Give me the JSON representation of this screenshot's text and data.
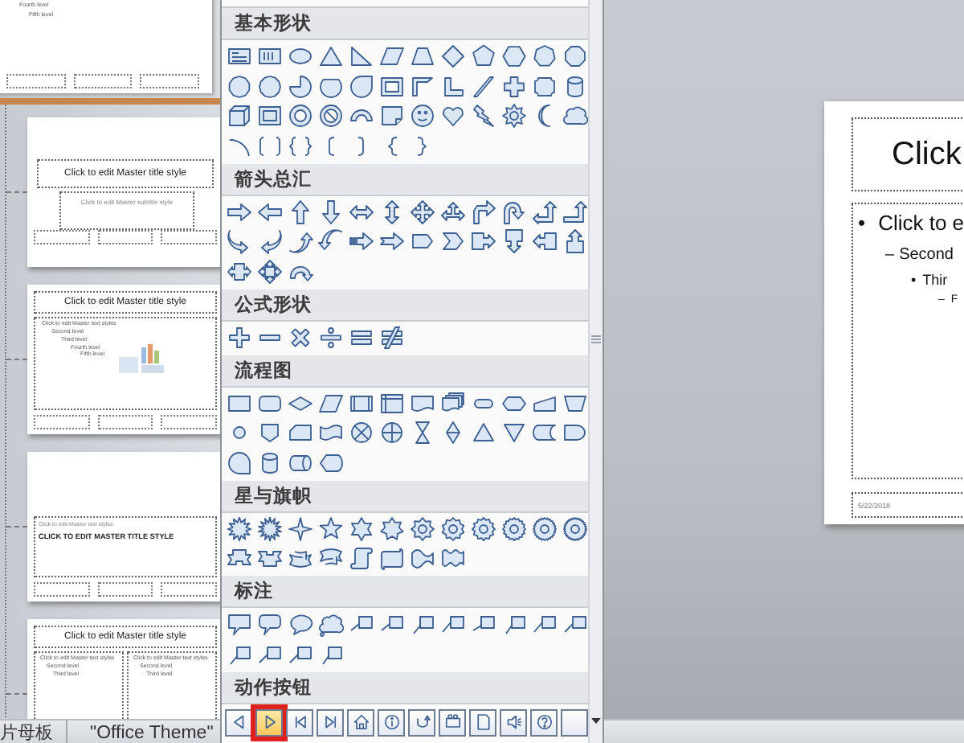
{
  "thumbnail_pane": {
    "partial_top": {
      "levels": [
        "Fourth level",
        "Fifth level"
      ]
    },
    "thumbnails": [
      {
        "kind": "title",
        "title": "Click to edit Master title style",
        "subtitle": "Click to edit Master subtitle style"
      },
      {
        "kind": "content",
        "title": "Click to edit Master title style",
        "levels": [
          "Click to edit Master text styles",
          "Second level",
          "Third level",
          "Fourth level",
          "Fifth level"
        ]
      },
      {
        "kind": "section",
        "text": "Click to edit Master text styles",
        "title": "CLICK TO EDIT MASTER TITLE STYLE"
      },
      {
        "kind": "two_content",
        "title": "Click to edit Master title style",
        "columns": [
          [
            "Click to edit Master text styles",
            "Second level",
            "Third level"
          ],
          [
            "Click to edit Master text styles",
            "Second level",
            "Third level"
          ]
        ]
      }
    ]
  },
  "shape_gallery": {
    "sections": [
      {
        "title": "基本形状"
      },
      {
        "title": "箭头总汇"
      },
      {
        "title": "公式形状"
      },
      {
        "title": "流程图"
      },
      {
        "title": "星与旗帜"
      },
      {
        "title": "标注"
      },
      {
        "title": "动作按钮",
        "shapes": [
          {
            "selected": false
          },
          {
            "selected": true
          },
          {
            "selected": false
          },
          {
            "selected": false
          },
          {
            "selected": false
          },
          {
            "selected": false
          },
          {
            "selected": false
          },
          {
            "selected": false
          },
          {
            "selected": false
          },
          {
            "selected": false
          },
          {
            "selected": false
          },
          {
            "selected": false
          }
        ]
      }
    ]
  },
  "slide": {
    "title": "Click",
    "bullets": [
      {
        "bullet": "•",
        "text": "Click to e"
      },
      {
        "bullet": "–",
        "text": "Second"
      },
      {
        "bullet": "•",
        "text": "Thir"
      },
      {
        "bullet": "–",
        "text": "F"
      }
    ],
    "date": "5/22/2018"
  },
  "status_bar": {
    "view": "片母板",
    "theme": "\"Office Theme\""
  }
}
